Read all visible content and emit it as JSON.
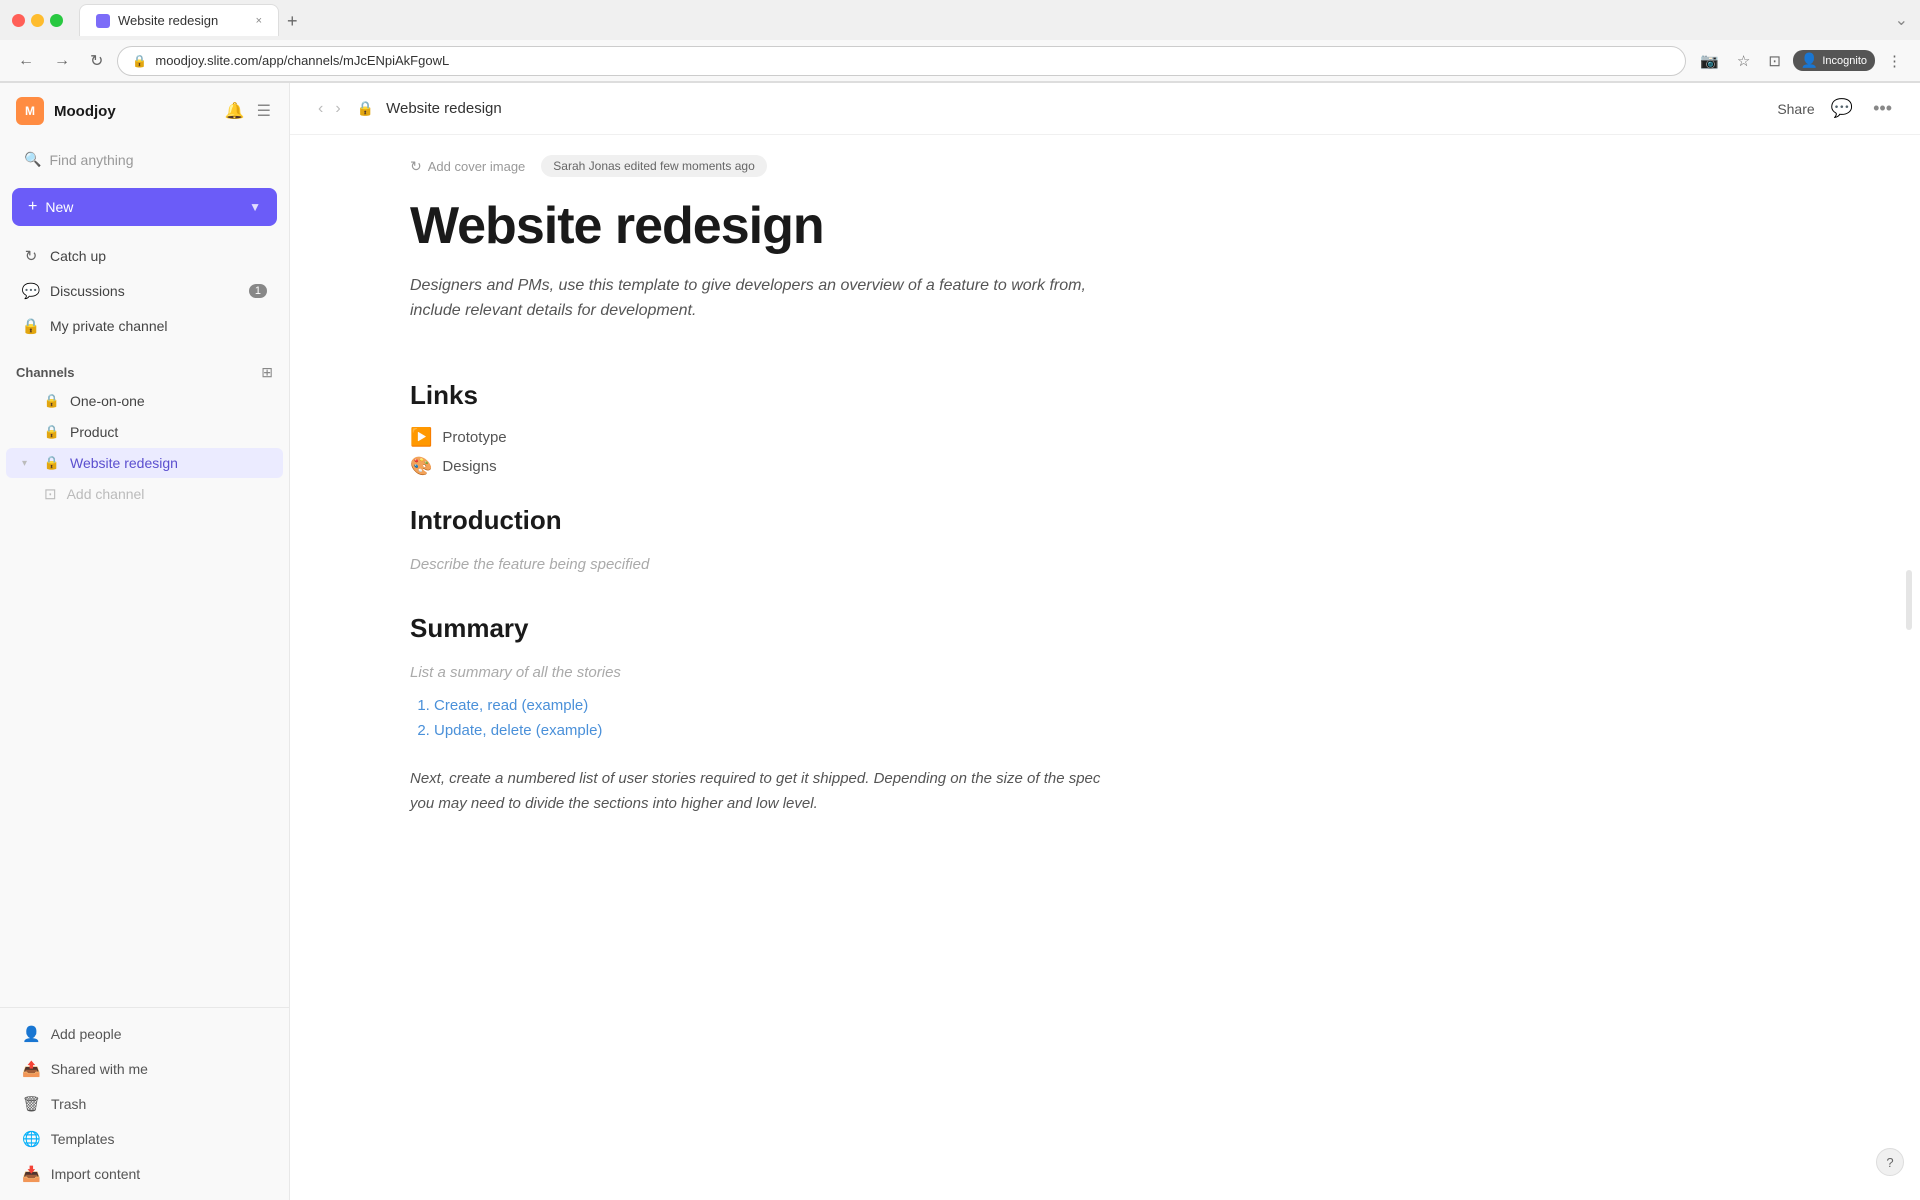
{
  "browser": {
    "tab_title": "Website redesign",
    "close_label": "×",
    "new_tab_label": "+",
    "back_label": "←",
    "forward_label": "→",
    "refresh_label": "↻",
    "address": "moodjoy.slite.com/app/channels/mJcENpiAkFgowL",
    "lock_label": "🔒",
    "incognito_label": "Incognito",
    "bookmark_label": "☆",
    "more_label": "⋮"
  },
  "workspace": {
    "name": "Moodjoy",
    "avatar_letter": "M"
  },
  "sidebar": {
    "search_placeholder": "Find anything",
    "new_label": "New",
    "new_arrow": "▼",
    "nav_items": [
      {
        "id": "catch-up",
        "icon": "↻",
        "label": "Catch up"
      },
      {
        "id": "discussions",
        "icon": "💬",
        "label": "Discussions",
        "badge": "1"
      },
      {
        "id": "private",
        "icon": "🔒",
        "label": "My private channel"
      }
    ],
    "channels_section": "Channels",
    "channels": [
      {
        "id": "one-on-one",
        "label": "One-on-one",
        "lock": true,
        "active": false
      },
      {
        "id": "product",
        "label": "Product",
        "lock": true,
        "active": false
      },
      {
        "id": "website-redesign",
        "label": "Website redesign",
        "lock": true,
        "active": true
      }
    ],
    "add_channel_label": "Add channel",
    "bottom_items": [
      {
        "id": "add-people",
        "icon": "👤",
        "label": "Add people"
      },
      {
        "id": "shared-with-me",
        "icon": "📤",
        "label": "Shared with me"
      },
      {
        "id": "trash",
        "icon": "🗑",
        "label": "Trash"
      },
      {
        "id": "templates",
        "icon": "🌐",
        "label": "Templates"
      },
      {
        "id": "import-content",
        "icon": "📥",
        "label": "Import content"
      }
    ]
  },
  "topbar": {
    "back_label": "‹",
    "forward_label": "›",
    "lock_icon": "🔒",
    "title": "Website redesign",
    "share_label": "Share",
    "comment_label": "💬",
    "more_label": "•••"
  },
  "document": {
    "add_cover_label": "Add cover image",
    "refresh_icon": "↻",
    "edit_info": "Sarah Jonas edited few moments ago",
    "title": "Website redesign",
    "subtitle": "Designers and PMs, use this template to give developers an overview of a feature to work from, include relevant details for development.",
    "links_heading": "Links",
    "links": [
      {
        "id": "prototype",
        "emoji": "▶️",
        "label": "Prototype"
      },
      {
        "id": "designs",
        "emoji": "🎨",
        "label": "Designs"
      }
    ],
    "introduction_heading": "Introduction",
    "introduction_placeholder": "Describe the feature being specified",
    "summary_heading": "Summary",
    "summary_placeholder": "List a summary of all the stories",
    "summary_list": [
      {
        "id": "item-1",
        "label": "Create, read (example)"
      },
      {
        "id": "item-2",
        "label": "Update, delete (example)"
      }
    ],
    "body_text": "Next, create a numbered list of user stories required to get it shipped. Depending on the size of the spec you may need to divide the sections into higher and low level."
  }
}
